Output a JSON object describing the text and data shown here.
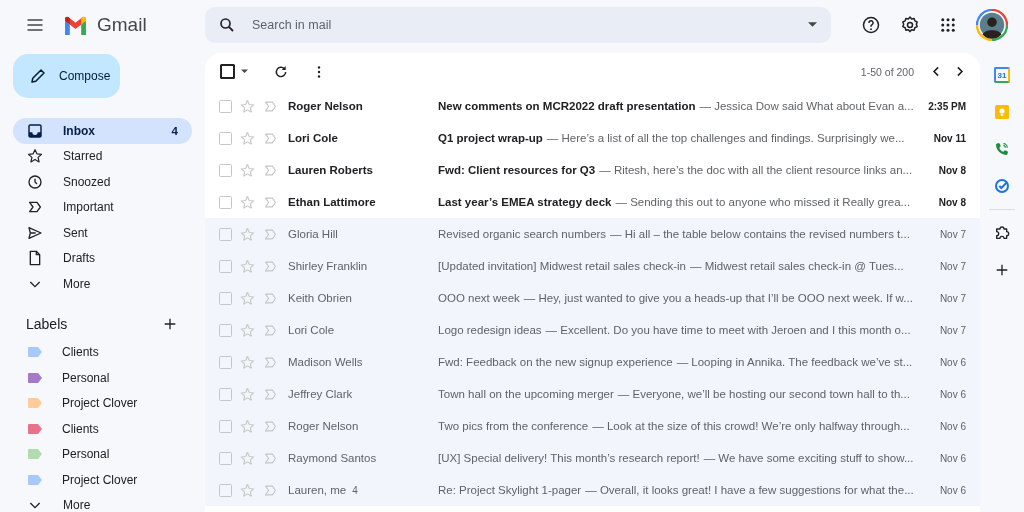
{
  "header": {
    "app_name": "Gmail",
    "search": {
      "placeholder": "Search in mail"
    }
  },
  "compose": {
    "label": "Compose"
  },
  "nav": [
    {
      "kind": "inbox",
      "label": "Inbox",
      "count": "4",
      "selected": true
    },
    {
      "kind": "starred",
      "label": "Starred",
      "selected": false
    },
    {
      "kind": "snoozed",
      "label": "Snoozed",
      "selected": false
    },
    {
      "kind": "important",
      "label": "Important",
      "selected": false
    },
    {
      "kind": "sent",
      "label": "Sent",
      "selected": false
    },
    {
      "kind": "drafts",
      "label": "Drafts",
      "selected": false
    },
    {
      "kind": "more",
      "label": "More",
      "selected": false
    }
  ],
  "labels": {
    "title": "Labels",
    "items": [
      {
        "label": "Clients",
        "color": "#a8c7fa"
      },
      {
        "label": "Personal",
        "color": "#a479c7"
      },
      {
        "label": "Project Clover",
        "color": "#ffcc99"
      },
      {
        "label": "Clients",
        "color": "#e8728a"
      },
      {
        "label": "Personal",
        "color": "#b3dbb0"
      },
      {
        "label": "Project Clover",
        "color": "#a8c7fa"
      }
    ],
    "more": "More"
  },
  "toolbar": {
    "range": "1-50 of 200",
    "select_all_checked": false
  },
  "emails": [
    {
      "sender": "Roger Nelson",
      "subject": "New comments on MCR2022 draft presentation",
      "snippet": "— Jessica Dow said What about Evan a...",
      "date": "2:35 PM",
      "unread": true,
      "starred": false
    },
    {
      "sender": "Lori Cole",
      "subject": "Q1 project wrap-up",
      "snippet": "— Here’s a list of all the top challenges and findings. Surprisingly we...",
      "date": "Nov 11",
      "unread": true,
      "starred": false
    },
    {
      "sender": "Lauren Roberts",
      "subject": "Fwd: Client resources for Q3",
      "snippet": "— Ritesh, here’s the doc with all the client resource links an...",
      "date": "Nov 8",
      "unread": true,
      "starred": false
    },
    {
      "sender": "Ethan Lattimore",
      "subject": "Last year’s EMEA strategy deck",
      "snippet": "— Sending this out to anyone who missed it Really grea...",
      "date": "Nov 8",
      "unread": true,
      "starred": false
    },
    {
      "sender": "Gloria Hill",
      "subject": "Revised organic search numbers",
      "snippet": "— Hi all – the table below contains the revised numbers t...",
      "date": "Nov 7",
      "unread": false,
      "starred": false
    },
    {
      "sender": "Shirley Franklin",
      "subject": "[Updated invitation] Midwest retail sales check-in",
      "snippet": "— Midwest retail sales check-in @ Tues...",
      "date": "Nov 7",
      "unread": false,
      "starred": false
    },
    {
      "sender": "Keith Obrien",
      "subject": "OOO next week",
      "snippet": "— Hey, just wanted to give you a heads-up that I’ll be OOO next week. If w...",
      "date": "Nov 7",
      "unread": false,
      "starred": false
    },
    {
      "sender": "Lori Cole",
      "subject": "Logo redesign ideas",
      "snippet": "— Excellent. Do you have time to meet with Jeroen and I this month o...",
      "date": "Nov 7",
      "unread": false,
      "starred": false
    },
    {
      "sender": "Madison Wells",
      "subject": "Fwd: Feedback on the new signup experience",
      "snippet": "— Looping in Annika. The feedback we’ve st...",
      "date": "Nov 6",
      "unread": false,
      "starred": false
    },
    {
      "sender": "Jeffrey Clark",
      "subject": "Town hall on the upcoming merger",
      "snippet": "— Everyone, we’ll be hosting our second town hall to th...",
      "date": "Nov 6",
      "unread": false,
      "starred": false
    },
    {
      "sender": "Roger Nelson",
      "subject": "Two pics from the conference",
      "snippet": "— Look at the size of this crowd! We’re only halfway through...",
      "date": "Nov 6",
      "unread": false,
      "starred": false
    },
    {
      "sender": "Raymond Santos",
      "subject": "[UX] Special delivery! This month’s research report!",
      "snippet": "— We have some exciting stuff to show...",
      "date": "Nov 6",
      "unread": false,
      "starred": false
    },
    {
      "sender": "Lauren, me",
      "thread_count": "4",
      "subject": "Re: Project Skylight 1-pager",
      "snippet": "— Overall, it looks great! I have a few suggestions for what the...",
      "date": "Nov 6",
      "unread": false,
      "starred": false
    }
  ],
  "side_rail": {
    "calendar_day": "31"
  }
}
